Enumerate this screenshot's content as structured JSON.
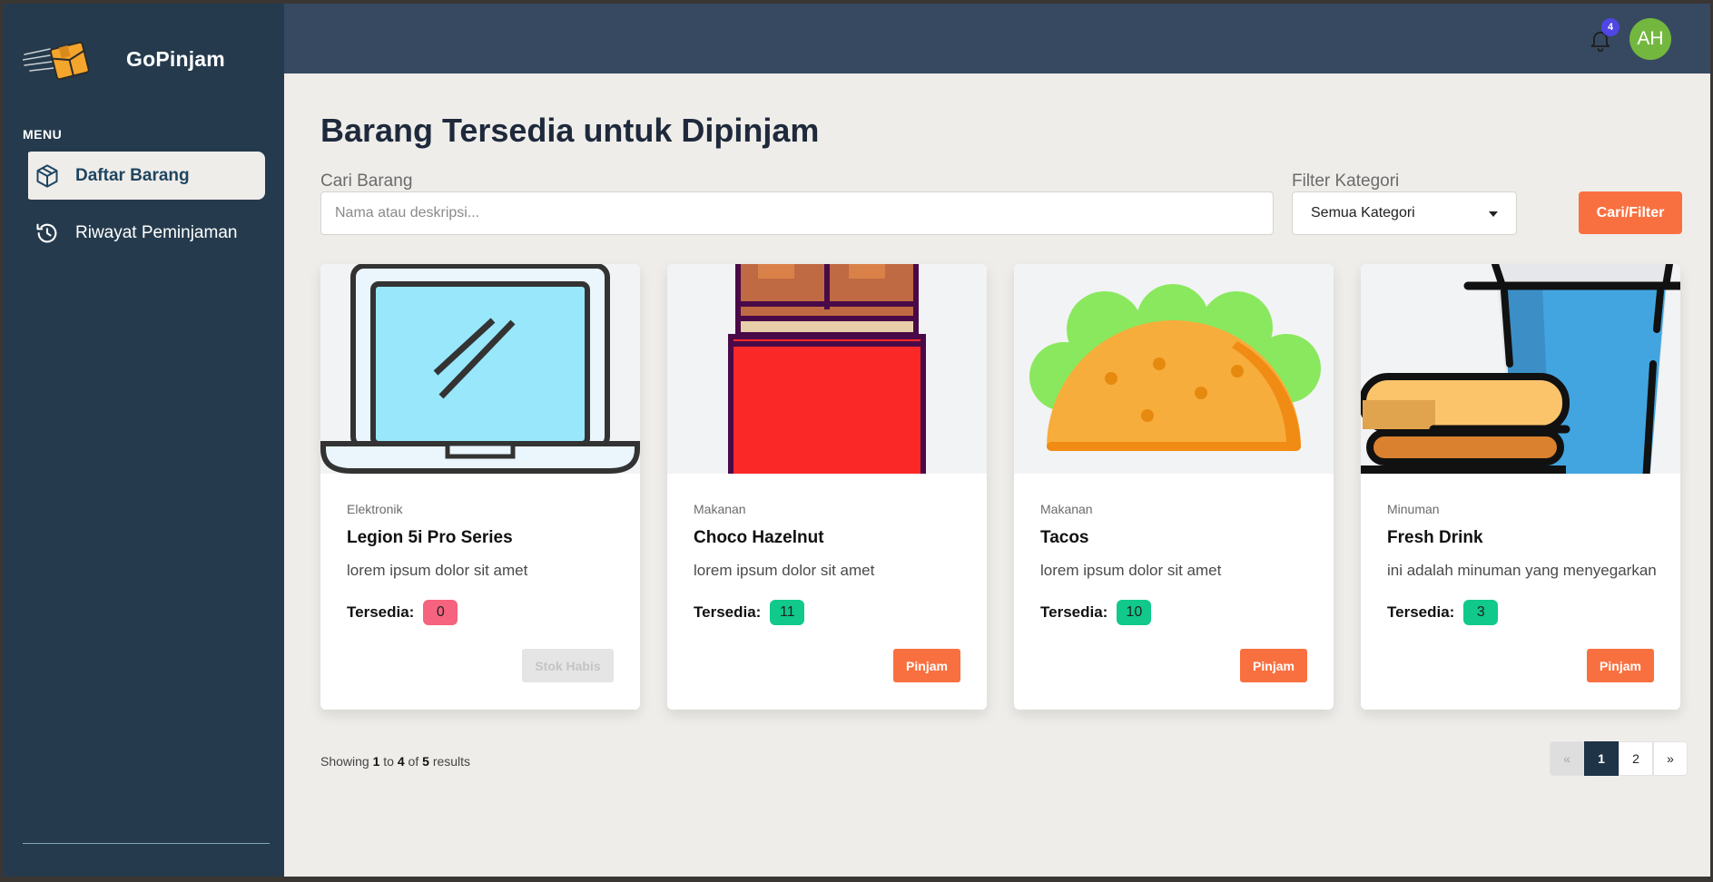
{
  "app": {
    "name": "GoPinjam"
  },
  "sidebar": {
    "menu_heading": "MENU",
    "items": [
      {
        "label": "Daftar Barang",
        "icon": "box-icon",
        "active": true
      },
      {
        "label": "Riwayat Peminjaman",
        "icon": "history-icon",
        "active": false
      }
    ]
  },
  "topbar": {
    "notification_count": "4",
    "avatar_initials": "AH"
  },
  "page": {
    "title": "Barang Tersedia untuk Dipinjam",
    "search": {
      "label": "Cari Barang",
      "placeholder": "Nama atau deskripsi...",
      "value": ""
    },
    "filter": {
      "label": "Filter Kategori",
      "selected": "Semua Kategori"
    },
    "filter_button": "Cari/Filter"
  },
  "items": [
    {
      "category": "Elektronik",
      "name": "Legion 5i Pro Series",
      "description": "lorem ipsum dolor sit amet",
      "stock_label": "Tersedia:",
      "stock": "0",
      "button": "Stok Habis",
      "image": "laptop-image"
    },
    {
      "category": "Makanan",
      "name": "Choco Hazelnut",
      "description": "lorem ipsum dolor sit amet",
      "stock_label": "Tersedia:",
      "stock": "11",
      "button": "Pinjam",
      "image": "chocolate-bar-image"
    },
    {
      "category": "Makanan",
      "name": "Tacos",
      "description": "lorem ipsum dolor sit amet",
      "stock_label": "Tersedia:",
      "stock": "10",
      "button": "Pinjam",
      "image": "taco-image"
    },
    {
      "category": "Minuman",
      "name": "Fresh Drink",
      "description": "ini adalah minuman yang menyegarkan",
      "stock_label": "Tersedia:",
      "stock": "3",
      "button": "Pinjam",
      "image": "drink-and-burger-image"
    }
  ],
  "pagination": {
    "showing_prefix": "Showing",
    "from": "1",
    "to_word": "to",
    "to": "4",
    "of_word": "of",
    "total": "5",
    "results_word": "results",
    "prev": "«",
    "pages": [
      "1",
      "2"
    ],
    "current_page": "1",
    "next": "»"
  },
  "colors": {
    "sidebar_bg": "#253b4d",
    "topbar_bg": "#364961",
    "accent_orange": "#f97040",
    "stock_empty": "#f5637e",
    "stock_ok": "#10c98b",
    "avatar_bg": "#74b73f",
    "notification_badge": "#4f46e5"
  }
}
